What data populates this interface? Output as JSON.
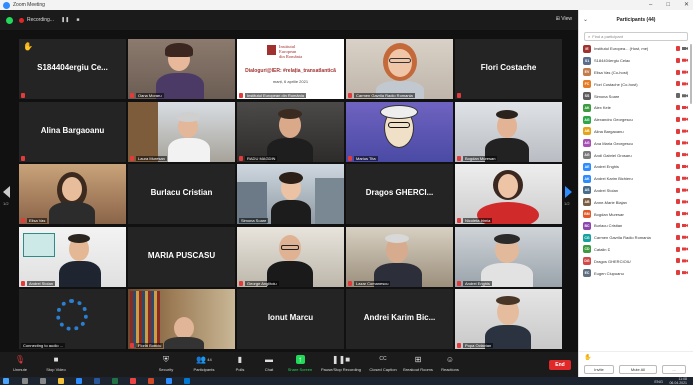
{
  "window": {
    "title": "Zoom Meeting"
  },
  "topbar": {
    "recording": "Recording...",
    "view_label": "View"
  },
  "tiles": {
    "t1": "S184404ergiu Ce...",
    "t2": "Oana Moraru",
    "t3_line1": "Institutul",
    "t3_line2": "European",
    "t3_line3": "din România",
    "t3_title": "Dialoguri@IER: #relația_transatlantică",
    "t3_date": "marți, 6 aprilie 2021",
    "t3_label": "Institutul European din România",
    "t4": "Carmen Gavrila Radio Romania",
    "t5": "Flori Costache",
    "t6": "Alina Bargaoanu",
    "t7": "Laura Muresan",
    "t8": "RADU MAGDIN",
    "t9": "Marius Tita",
    "t10": "Bogdan Muresan",
    "t11": "Elisa Vas",
    "t12": "Burlacu Cristian",
    "t13": "Simona Soare",
    "t14": "Dragos GHERCI...",
    "t15": "Nicoleta Irimia",
    "t16": "Andrei Stoian",
    "t17": "MARIA PUSCASU",
    "t18": "George Anglitoiu",
    "t19": "Lazar Comanescu",
    "t20": "Andrei Enghis",
    "t21": "Connecting to audio ...",
    "t22": "Florin Bonciu",
    "t23": "Ionut Marcu",
    "t24": "Andrei Karim Bic...",
    "t25": "Popa Octavian"
  },
  "pages": {
    "left": "1/2",
    "right": "1/2"
  },
  "toolbar": {
    "unmute": "Unmute",
    "stop_video": "Stop Video",
    "security": "Security",
    "participants": "Participants",
    "participants_count": "44",
    "polls": "Polls",
    "chat": "Chat",
    "share": "Share Screen",
    "pause_rec": "Pause/Stop Recording",
    "cc": "Closed Caption",
    "breakout": "Breakout Rooms",
    "reactions": "Reactions",
    "end": "End"
  },
  "panel": {
    "title": "Participants (44)",
    "search_placeholder": "Find a participant",
    "participants": [
      {
        "initials": "IE",
        "name": "Institutul Europea... (Host, me)",
        "color": "#a0312f"
      },
      {
        "initials": "S1",
        "name": "S184404ergiu Celac",
        "color": "#5a6e8c"
      },
      {
        "initials": "EV",
        "name": "Elisa Vas (Co-host)",
        "color": "#c27c4a"
      },
      {
        "initials": "FC",
        "name": "Flori Costache (Co-host)",
        "color": "#e57b22"
      },
      {
        "initials": "SS",
        "name": "Simona Soare",
        "color": "#5d5d5d"
      },
      {
        "initials": "AK",
        "name": "Alex Kele",
        "color": "#3c9a3f"
      },
      {
        "initials": "AG",
        "name": "Alexandru Georgescu",
        "color": "#2da64a"
      },
      {
        "initials": "AB",
        "name": "Alina Bargaoanu",
        "color": "#e5a417"
      },
      {
        "initials": "AG",
        "name": "Ana Maria Georgescu",
        "color": "#a84fb5"
      },
      {
        "initials": "AG",
        "name": "Andi Gabriel Grosaru",
        "color": "#7a7a7a"
      },
      {
        "initials": "AE",
        "name": "Andrei Enghis",
        "color": "#2d8cff"
      },
      {
        "initials": "AK",
        "name": "Andrei Karim Bichieru",
        "color": "#2d8cff"
      },
      {
        "initials": "AS",
        "name": "Andrei Stoian",
        "color": "#4a6b8a"
      },
      {
        "initials": "AB",
        "name": "Anne-Marie Blajan",
        "color": "#7b5c44"
      },
      {
        "initials": "BM",
        "name": "Bogdan Muresan",
        "color": "#e05a2a"
      },
      {
        "initials": "BC",
        "name": "Burlacu Cristian",
        "color": "#8e44ad"
      },
      {
        "initials": "CG",
        "name": "Carmen Gavrila Radio Romania",
        "color": "#16a0a0"
      },
      {
        "initials": "CD",
        "name": "Catalin D",
        "color": "#3c9a3f"
      },
      {
        "initials": "DG",
        "name": "Dragos GHERCIOIU",
        "color": "#d04848"
      },
      {
        "initials": "EC",
        "name": "Eugen Ciupuanu",
        "color": "#5e6f80"
      }
    ],
    "invite": "Invite",
    "mute_all": "Mute All",
    "more": "..."
  },
  "taskbar": {
    "lang": "ENG",
    "time": "11:08",
    "date": "06.04.2021"
  }
}
